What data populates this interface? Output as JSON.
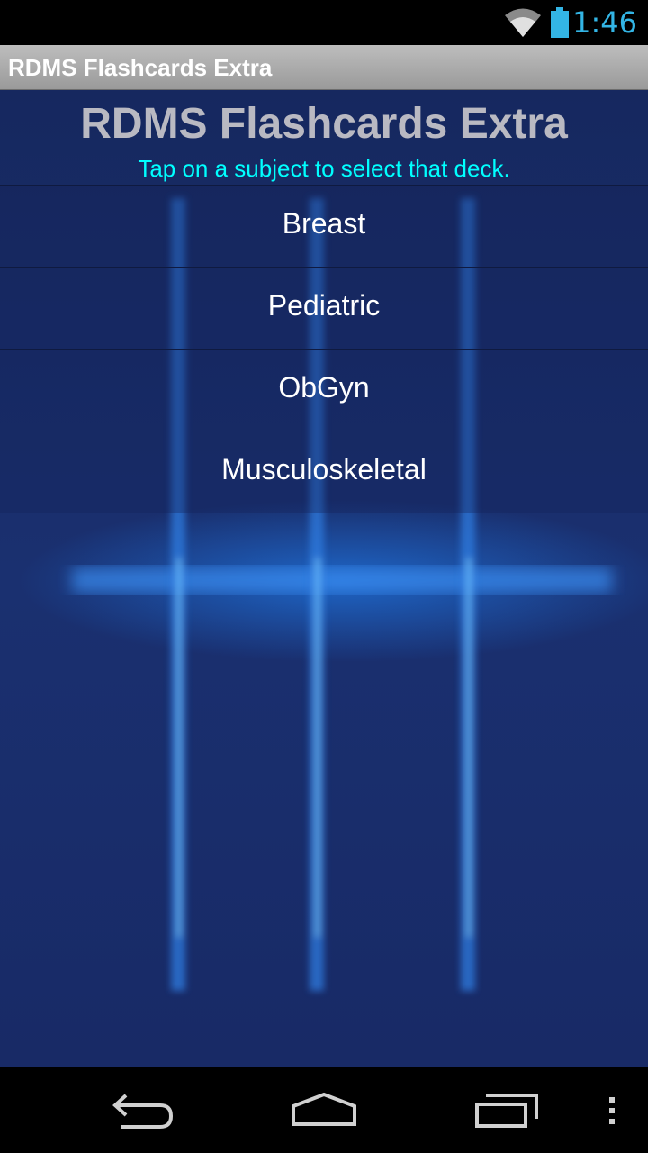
{
  "status_bar": {
    "time": "1:46",
    "icons": [
      "wifi-icon",
      "battery-icon"
    ],
    "accent_color": "#33b5e5"
  },
  "title_bar": {
    "title": "RDMS Flashcards Extra"
  },
  "main": {
    "heading": "RDMS Flashcards Extra",
    "instruction": "Tap on a subject to select that deck.",
    "decks": [
      {
        "label": "Breast"
      },
      {
        "label": "Pediatric"
      },
      {
        "label": "ObGyn"
      },
      {
        "label": "Musculoskeletal"
      }
    ],
    "colors": {
      "background": "#1a2c68",
      "heading": "#b9b9c2",
      "instruction": "#00ffff"
    }
  },
  "nav_bar": {
    "buttons": [
      "back-icon",
      "home-icon",
      "recent-apps-icon",
      "overflow-menu-icon"
    ]
  }
}
